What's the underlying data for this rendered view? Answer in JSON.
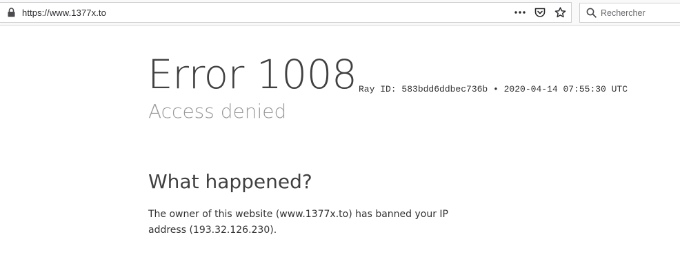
{
  "browser": {
    "url": "https://www.1377x.to",
    "search_placeholder": "Rechercher",
    "icons": {
      "lock": "lock-icon",
      "more": "ellipsis-icon",
      "pocket": "pocket-icon",
      "bookmark": "star-icon",
      "search": "search-icon"
    }
  },
  "page": {
    "error_title": "Error 1008",
    "ray_line": "Ray ID: 583bdd6ddbec736b • 2020-04-14 07:55:30 UTC",
    "subtitle": "Access denied",
    "section_heading": "What happened?",
    "section_text": "The owner of this website (www.1377x.to) has banned your IP address (193.32.126.230)."
  }
}
